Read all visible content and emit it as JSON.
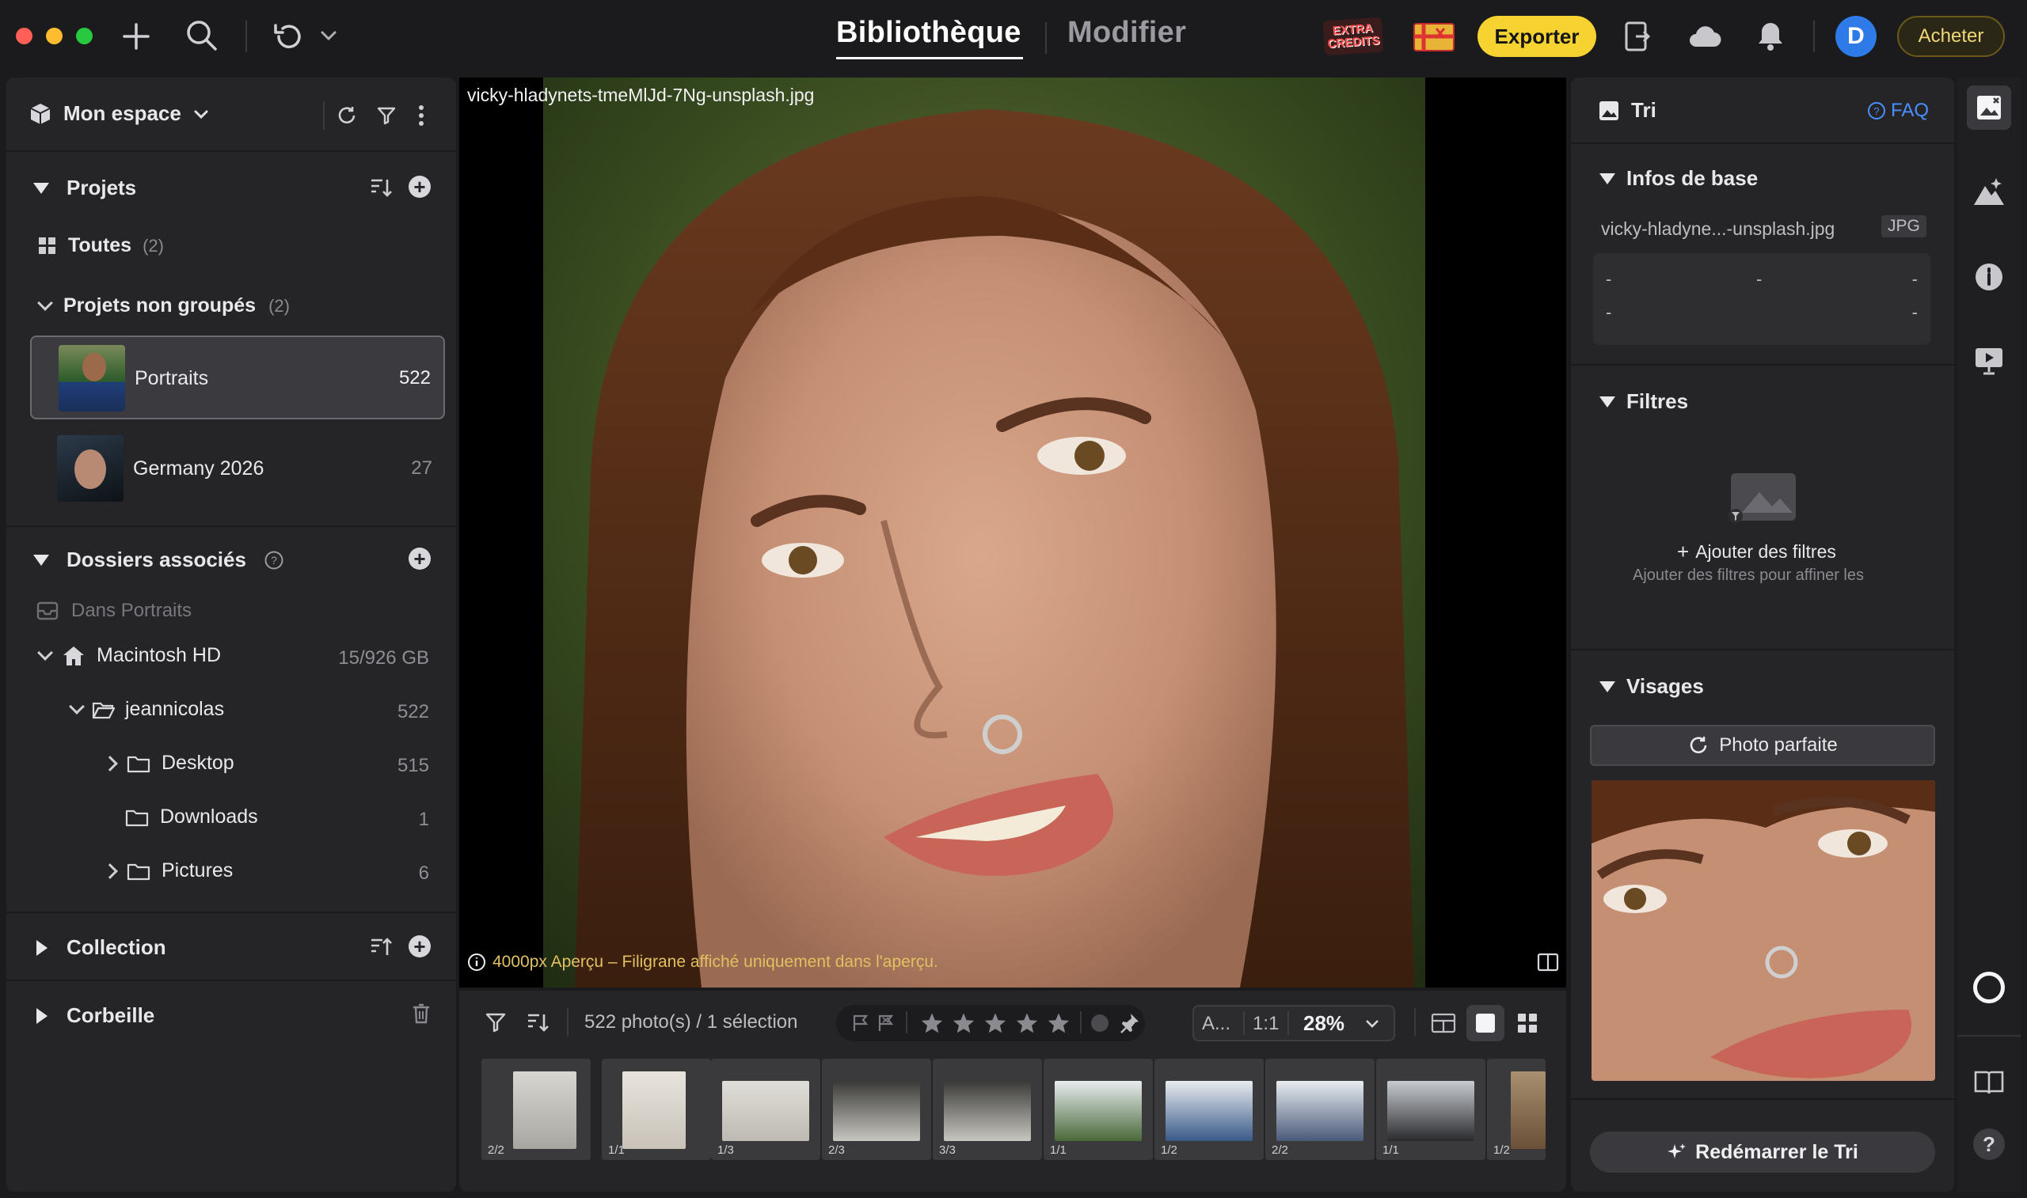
{
  "window": {
    "tabs": [
      {
        "label": "Bibliothèque",
        "active": true
      },
      {
        "label": "Modifier",
        "active": false
      }
    ],
    "promo_badge_text": "EXTRA CREDITS",
    "export_label": "Exporter",
    "avatar_initial": "D",
    "buy_label": "Acheter"
  },
  "sidebar": {
    "workspace_label": "Mon espace",
    "projects_header": "Projets",
    "all_label": "Toutes",
    "all_count": "(2)",
    "ungrouped_label": "Projets non groupés",
    "ungrouped_count": "(2)",
    "projects": [
      {
        "name": "Portraits",
        "count": "522",
        "selected": true
      },
      {
        "name": "Germany 2026",
        "count": "27",
        "selected": false
      }
    ],
    "folders_header": "Dossiers associés",
    "in_project_label": "Dans Portraits",
    "drive_label": "Macintosh HD",
    "drive_usage": "15/926 GB",
    "tree": [
      {
        "name": "jeannicolas",
        "count": "522"
      },
      {
        "name": "Desktop",
        "count": "515"
      },
      {
        "name": "Downloads",
        "count": "1"
      },
      {
        "name": "Pictures",
        "count": "6"
      }
    ],
    "collection_label": "Collection",
    "trash_label": "Corbeille"
  },
  "viewer": {
    "filename": "vicky-hladynets-tmeMlJd-7Ng-unsplash.jpg",
    "watermark_note": "4000px Aperçu – Filigrane affiché uniquement dans l'aperçu."
  },
  "toolbar": {
    "photo_count": "522 photo(s) / 1 sélectionn",
    "auto_label": "A...",
    "one_to_one": "1:1",
    "zoom": "28%"
  },
  "filmstrip": {
    "counts": [
      "2/2",
      "1/1",
      "1/3",
      "2/3",
      "3/3",
      "1/1",
      "1/2",
      "2/2",
      "1/1",
      "1/2"
    ]
  },
  "right_panel": {
    "title": "Tri",
    "faq": "FAQ",
    "basic_info_header": "Infos de base",
    "file_short": "vicky-hladyne...-unsplash.jpg",
    "format": "JPG",
    "placeholder_dash": "-",
    "filters_header": "Filtres",
    "add_filters": "Ajouter des filtres",
    "add_filters_hint": "Ajouter des filtres pour affiner les",
    "faces_header": "Visages",
    "perfect_photo": "Photo parfaite",
    "restart_label": "Redémarrer le Tri"
  },
  "colors": {
    "accent_yellow": "#f6d330",
    "avatar_blue": "#2d7ae8",
    "panel_bg": "#252528",
    "window_bg": "#1b1b1d"
  }
}
